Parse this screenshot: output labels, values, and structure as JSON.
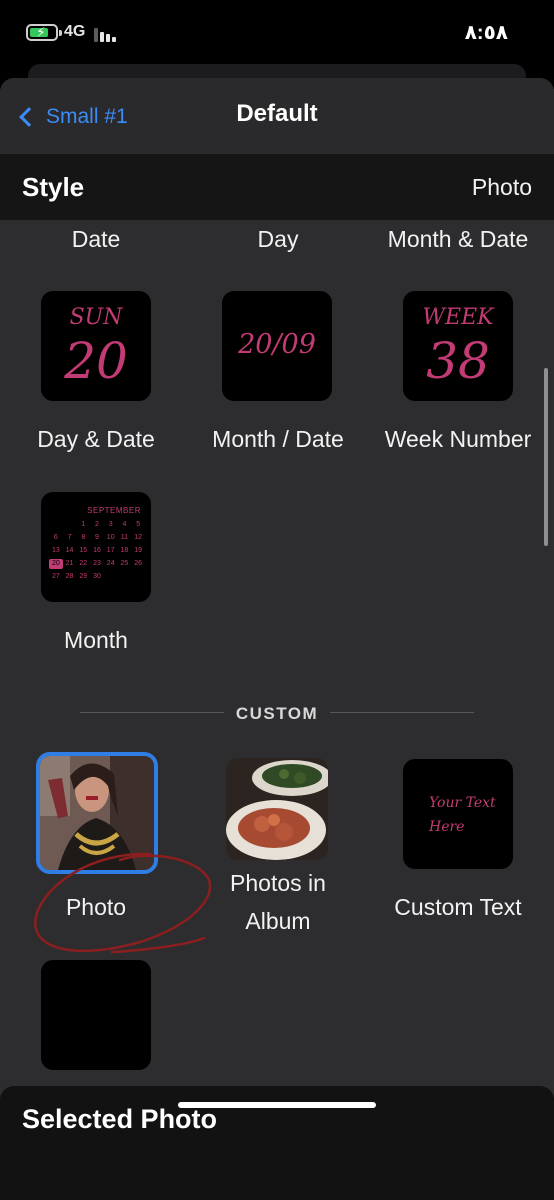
{
  "status_bar": {
    "network": "4G",
    "time": "٨:٥٨",
    "battery_level": 0.75
  },
  "nav": {
    "back_label": "Small #1",
    "title": "Default"
  },
  "style_header": {
    "label": "Style",
    "value": "Photo"
  },
  "top_row_labels": [
    "Date",
    "Day",
    "Month & Date"
  ],
  "widgets": {
    "day_date": {
      "label": "Day & Date",
      "weekday": "SUN",
      "day": "20"
    },
    "month_date": {
      "label": "Month / Date",
      "text": "20/09"
    },
    "week_number": {
      "label": "Week Number",
      "caption": "WEEK",
      "number": "38"
    },
    "month": {
      "label": "Month",
      "month_name": "SEPTEMBER",
      "days": [
        "",
        "",
        "1",
        "2",
        "3",
        "4",
        "5",
        "6",
        "7",
        "8",
        "9",
        "10",
        "11",
        "12",
        "13",
        "14",
        "15",
        "16",
        "17",
        "18",
        "19",
        "20",
        "21",
        "22",
        "23",
        "24",
        "25",
        "26",
        "27",
        "28",
        "29",
        "30"
      ],
      "today": "20"
    }
  },
  "custom_section": {
    "title": "CUSTOM"
  },
  "custom_widgets": {
    "photo": {
      "label": "Photo"
    },
    "photos_in_album": {
      "label_line1": "Photos in",
      "label_line2": "Album"
    },
    "custom_text": {
      "label": "Custom Text",
      "sample_line1": "Your Text",
      "sample_line2": "Here"
    }
  },
  "bottom_panel": {
    "title": "Selected Photo"
  },
  "colors": {
    "accent": "#c23b74",
    "link": "#3b8cf7",
    "selection": "#2f7ee6",
    "annotation": "#8b1f1f"
  }
}
